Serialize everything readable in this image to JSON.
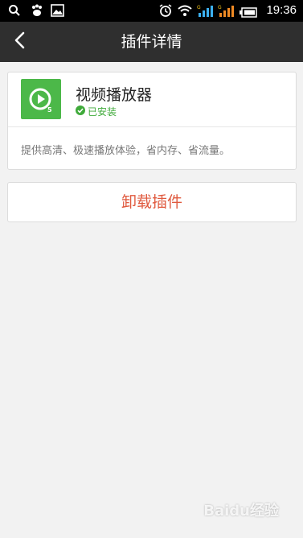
{
  "status_bar": {
    "time": "19:36",
    "icons": [
      "search-icon",
      "baidu-paw-icon",
      "image-icon",
      "alarm-icon",
      "wifi-icon",
      "signal-icon",
      "signal-icon",
      "battery-icon"
    ]
  },
  "nav": {
    "title": "插件详情",
    "back_icon": "back-arrow-icon"
  },
  "plugin": {
    "name": "视频播放器",
    "status": "已安装",
    "description": "提供高清、极速播放体验，省内存、省流量。",
    "icon": "video-player-icon",
    "icon_color": "#4cb849"
  },
  "actions": {
    "uninstall_label": "卸载插件",
    "uninstall_color": "#e05a3f"
  },
  "watermark": {
    "text": "Baidu经验"
  }
}
